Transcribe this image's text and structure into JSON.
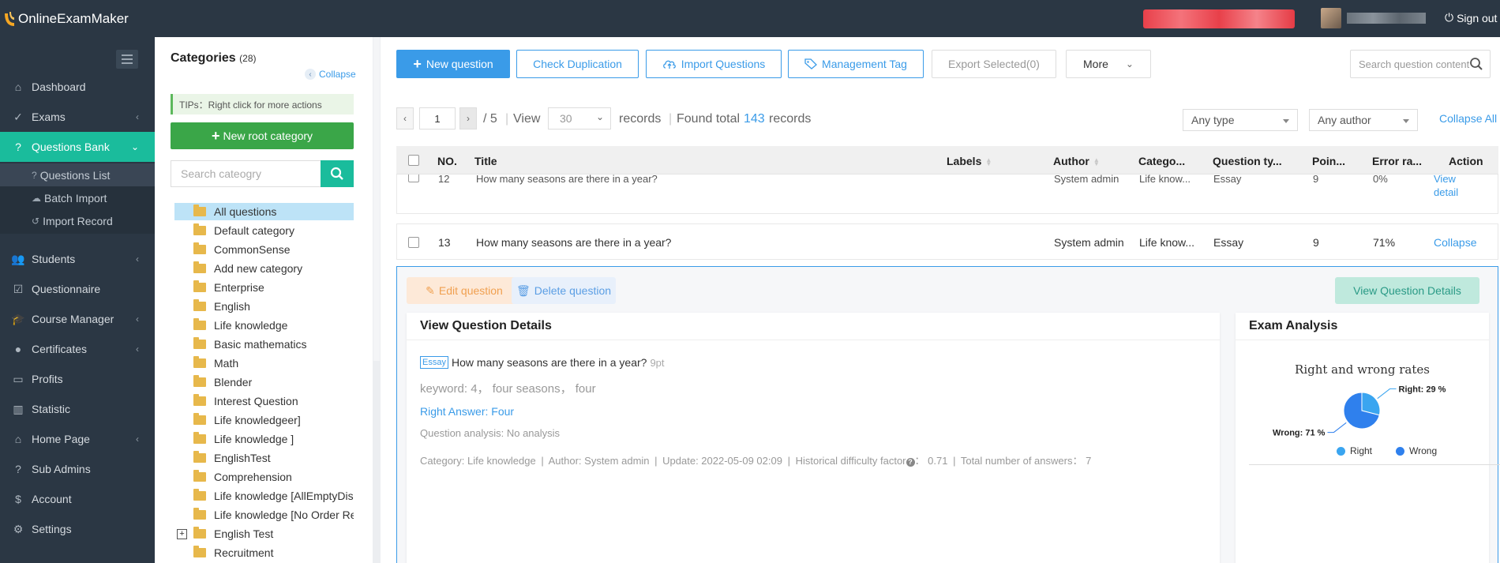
{
  "app": {
    "logo_text": "OnlineExamMaker",
    "signout_label": "Sign out"
  },
  "nav": {
    "items": [
      {
        "label": "Dashboard",
        "icon": "home-icon"
      },
      {
        "label": "Exams",
        "icon": "check-circle-icon"
      },
      {
        "label": "Questions Bank",
        "icon": "question-circle-icon"
      },
      {
        "label": "Students",
        "icon": "users-icon"
      },
      {
        "label": "Questionnaire",
        "icon": "checkbox-icon"
      },
      {
        "label": "Course Manager",
        "icon": "graduation-cap-icon"
      },
      {
        "label": "Certificates",
        "icon": "badge-icon"
      },
      {
        "label": "Profits",
        "icon": "card-icon"
      },
      {
        "label": "Statistic",
        "icon": "bar-chart-icon"
      },
      {
        "label": "Home Page",
        "icon": "house-icon"
      },
      {
        "label": "Sub Admins",
        "icon": "question-circle-icon"
      },
      {
        "label": "Account",
        "icon": "dollar-icon"
      },
      {
        "label": "Settings",
        "icon": "gear-icon"
      }
    ],
    "sub_items": [
      {
        "label": "Questions List"
      },
      {
        "label": "Batch Import"
      },
      {
        "label": "Import Record"
      }
    ]
  },
  "categories": {
    "title": "Categories",
    "count": "(28)",
    "collapse_label": "Collapse",
    "tips": "TIPs：Right click for more actions",
    "new_root_label": "New root category",
    "search_placeholder": "Search cateogry",
    "items": [
      "All questions",
      "Default category",
      "CommonSense",
      "Add new category",
      "Enterprise",
      "English",
      "Life knowledge",
      "Basic mathematics",
      "Math",
      "Blender",
      "Interest Question",
      "Life knowledgeer]",
      "Life knowledge ]",
      "EnglishTest",
      "Comprehension",
      "Life knowledge [AllEmptyDisc",
      "Life knowledge [No Order Re",
      "English Test",
      "Recruitment"
    ]
  },
  "toolbar": {
    "new_question": "New question",
    "check_duplication": "Check Duplication",
    "import_questions": "Import Questions",
    "management_tag": "Management Tag",
    "export_selected": "Export Selected(0)",
    "more": "More",
    "search_placeholder": "Search question content"
  },
  "pager": {
    "page": "1",
    "total_pages": "/ 5",
    "view_label": "View",
    "per_page": "30",
    "records_label": "records",
    "found_label": "Found total",
    "found_count": "143",
    "records_suffix": "records",
    "type_filter": "Any type",
    "author_filter": "Any author",
    "collapse_all": "Collapse All"
  },
  "table": {
    "headers": {
      "no": "NO.",
      "title": "Title",
      "labels": "Labels",
      "author": "Author",
      "category": "Catego...",
      "type": "Question ty...",
      "points": "Poin...",
      "error": "Error ra...",
      "action": "Action"
    },
    "rows": [
      {
        "no": "12",
        "title": "How many seasons are there in a year?",
        "author": "System admin",
        "category": "Life know...",
        "type": "Essay",
        "points": "9",
        "error": "0%",
        "action1": "View",
        "action2": "detail"
      },
      {
        "no": "13",
        "title": "How many seasons are there in a year?",
        "author": "System admin",
        "category": "Life know...",
        "type": "Essay",
        "points": "9",
        "error": "71%",
        "action1": "Collapse"
      }
    ]
  },
  "detail": {
    "edit_label": "Edit question",
    "delete_label": "Delete question",
    "view_label": "View Question Details",
    "card_title": "View Question Details",
    "tag": "Essay",
    "question": "How many seasons are there in a year?",
    "points": "9pt",
    "keyword": "keyword: 4， four seasons， four",
    "right_answer": "Right Answer: Four",
    "analysis": "Question analysis: No analysis",
    "meta_category": "Category: Life knowledge",
    "meta_author": "Author: System admin",
    "meta_update": "Update: 2022-05-09 02:09",
    "meta_difficulty_label": "Historical difficulty factor",
    "meta_difficulty_value": "： 0.71",
    "meta_total": "Total number of answers： 7"
  },
  "exam_analysis": {
    "card_title": "Exam Analysis",
    "chart_data": {
      "type": "pie",
      "title": "Right and wrong rates",
      "series": [
        {
          "name": "Right",
          "value": 29,
          "label": "Right: 29 %",
          "color": "#3aa5f0"
        },
        {
          "name": "Wrong",
          "value": 71,
          "label": "Wrong: 71 %",
          "color": "#2f80ed"
        }
      ],
      "legend": "bottom"
    }
  },
  "colors": {
    "primary": "#3a9be8",
    "teal": "#1abc9c",
    "nav_bg": "#2b3744"
  }
}
